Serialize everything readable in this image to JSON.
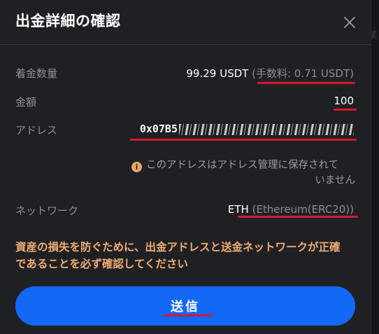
{
  "dialog": {
    "title": "出金詳細の確認",
    "close_icon": "close-icon"
  },
  "background": {
    "partial_text": "某"
  },
  "rows": {
    "amount_received": {
      "label": "着金数量",
      "value": "99.29 USDT",
      "fee": "(手数料: 0.71 USDT)"
    },
    "amount": {
      "label": "金額",
      "value": "100"
    },
    "address": {
      "label": "アドレス",
      "value": "0x07B5"
    },
    "notice": {
      "icon": "info-icon",
      "line1": "このアドレスはアドレス管理に保存されて",
      "line2": "いません"
    },
    "network": {
      "label": "ネットワーク",
      "value": "ETH",
      "detail": "(Ethereum(ERC20))"
    }
  },
  "warning": {
    "line1": "資産の損失を防ぐために、出金アドレスと送金ネットワークが正確",
    "line2": "であることを必ず確認してください"
  },
  "send_button": {
    "label": "送信"
  },
  "colors": {
    "dialog_bg": "#1f2024",
    "primary": "#1368f5",
    "warning": "#f1ad72",
    "annotation": "#d8182b"
  }
}
